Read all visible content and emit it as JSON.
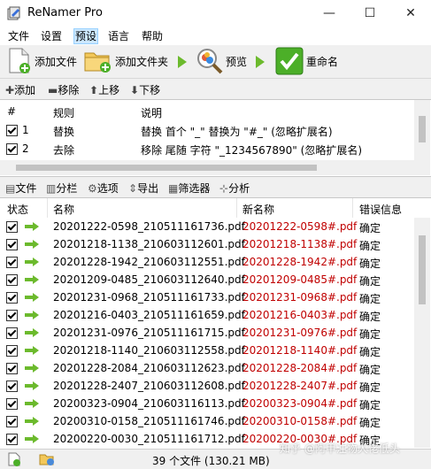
{
  "window": {
    "title": "ReNamer Pro",
    "minimize": "—",
    "maximize": "☐",
    "close": "✕"
  },
  "menu": [
    "文件",
    "设置",
    "预设",
    "语言",
    "帮助"
  ],
  "toolbar": {
    "add_files": "添加文件",
    "add_folder": "添加文件夹",
    "preview": "预览",
    "rename": "重命名"
  },
  "rules_toolbar": {
    "add": "添加",
    "remove": "移除",
    "up": "上移",
    "down": "下移"
  },
  "rules": {
    "headers": {
      "num": "#",
      "rule": "规则",
      "desc": "说明"
    },
    "rows": [
      {
        "num": "1",
        "rule": "替换",
        "desc": "替换 首个 \"_\" 替换为 \"#_\" (忽略扩展名)"
      },
      {
        "num": "2",
        "rule": "去除",
        "desc": "移除 尾随 字符 \"_1234567890\" (忽略扩展名)"
      }
    ]
  },
  "files_toolbar": {
    "files": "文件",
    "columns": "分栏",
    "options": "选项",
    "export": "导出",
    "filter": "筛选器",
    "analyze": "分析"
  },
  "files": {
    "headers": {
      "status": "状态",
      "name": "名称",
      "new_name": "新名称",
      "error": "错误信息"
    },
    "rows": [
      {
        "name": "20201222-0598_210511161736.pdf",
        "new_name": "20201222-0598#.pdf",
        "error": "确定"
      },
      {
        "name": "20201218-1138_210603112601.pdf",
        "new_name": "20201218-1138#.pdf",
        "error": "确定"
      },
      {
        "name": "20201228-1942_210603112551.pdf",
        "new_name": "20201228-1942#.pdf",
        "error": "确定"
      },
      {
        "name": "20201209-0485_210603112640.pdf",
        "new_name": "20201209-0485#.pdf",
        "error": "确定"
      },
      {
        "name": "20201231-0968_210511161733.pdf",
        "new_name": "20201231-0968#.pdf",
        "error": "确定"
      },
      {
        "name": "20201216-0403_210511161659.pdf",
        "new_name": "20201216-0403#.pdf",
        "error": "确定"
      },
      {
        "name": "20201231-0976_210511161715.pdf",
        "new_name": "20201231-0976#.pdf",
        "error": "确定"
      },
      {
        "name": "20201218-1140_210603112558.pdf",
        "new_name": "20201218-1140#.pdf",
        "error": "确定"
      },
      {
        "name": "20201228-2084_210603112623.pdf",
        "new_name": "20201228-2084#.pdf",
        "error": "确定"
      },
      {
        "name": "20201228-2407_210603112608.pdf",
        "new_name": "20201228-2407#.pdf",
        "error": "确定"
      },
      {
        "name": "20200323-0904_210603116113.pdf",
        "new_name": "20200323-0904#.pdf",
        "error": "确定"
      },
      {
        "name": "20200310-0158_210511161746.pdf",
        "new_name": "20200310-0158#.pdf",
        "error": "确定"
      },
      {
        "name": "20200220-0030_210511161712.pdf",
        "new_name": "20200220-0030#.pdf",
        "error": "确定"
      }
    ]
  },
  "status": {
    "summary": "39 个文件 (130.21 MB)"
  },
  "watermark": "知乎 @阿甲注物大佬低头"
}
